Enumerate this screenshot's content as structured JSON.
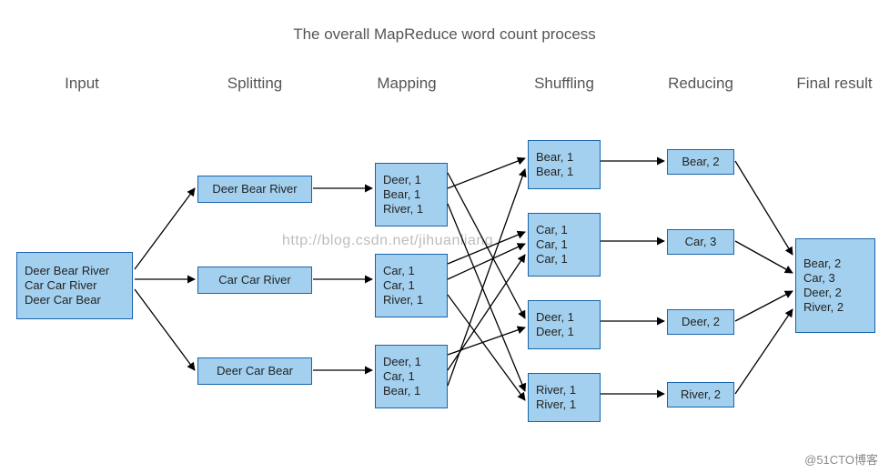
{
  "title": "The overall MapReduce word count process",
  "headers": {
    "input": "Input",
    "splitting": "Splitting",
    "mapping": "Mapping",
    "shuffling": "Shuffling",
    "reducing": "Reducing",
    "final": "Final result"
  },
  "input": {
    "l1": "Deer Bear River",
    "l2": "Car Car River",
    "l3": "Deer Car Bear"
  },
  "split": {
    "s1": "Deer Bear River",
    "s2": "Car Car River",
    "s3": "Deer Car Bear"
  },
  "map": {
    "m1": {
      "a": "Deer, 1",
      "b": "Bear, 1",
      "c": "River, 1"
    },
    "m2": {
      "a": "Car, 1",
      "b": "Car, 1",
      "c": "River, 1"
    },
    "m3": {
      "a": "Deer, 1",
      "b": "Car, 1",
      "c": "Bear, 1"
    }
  },
  "shuffle": {
    "bear": {
      "a": "Bear, 1",
      "b": "Bear, 1"
    },
    "car": {
      "a": "Car, 1",
      "b": "Car, 1",
      "c": "Car, 1"
    },
    "deer": {
      "a": "Deer, 1",
      "b": "Deer, 1"
    },
    "river": {
      "a": "River, 1",
      "b": "River, 1"
    }
  },
  "reduce": {
    "bear": "Bear, 2",
    "car": "Car, 3",
    "deer": "Deer, 2",
    "river": "River, 2"
  },
  "final": {
    "a": "Bear, 2",
    "b": "Car, 3",
    "c": "Deer, 2",
    "d": "River, 2"
  },
  "watermark": "http://blog.csdn.net/jihuanliang",
  "credit": "@51CTO博客",
  "chart_data": {
    "type": "table",
    "stages": [
      "Input",
      "Splitting",
      "Mapping",
      "Shuffling",
      "Reducing",
      "Final result"
    ],
    "input_text": "Deer Bear River\nCar Car River\nDeer Car Bear",
    "splits": [
      "Deer Bear River",
      "Car Car River",
      "Deer Car Bear"
    ],
    "map_output": [
      [
        [
          "Deer",
          1
        ],
        [
          "Bear",
          1
        ],
        [
          "River",
          1
        ]
      ],
      [
        [
          "Car",
          1
        ],
        [
          "Car",
          1
        ],
        [
          "River",
          1
        ]
      ],
      [
        [
          "Deer",
          1
        ],
        [
          "Car",
          1
        ],
        [
          "Bear",
          1
        ]
      ]
    ],
    "shuffle_groups": {
      "Bear": [
        1,
        1
      ],
      "Car": [
        1,
        1,
        1
      ],
      "Deer": [
        1,
        1
      ],
      "River": [
        1,
        1
      ]
    },
    "reduce_output": {
      "Bear": 2,
      "Car": 3,
      "Deer": 2,
      "River": 2
    }
  }
}
